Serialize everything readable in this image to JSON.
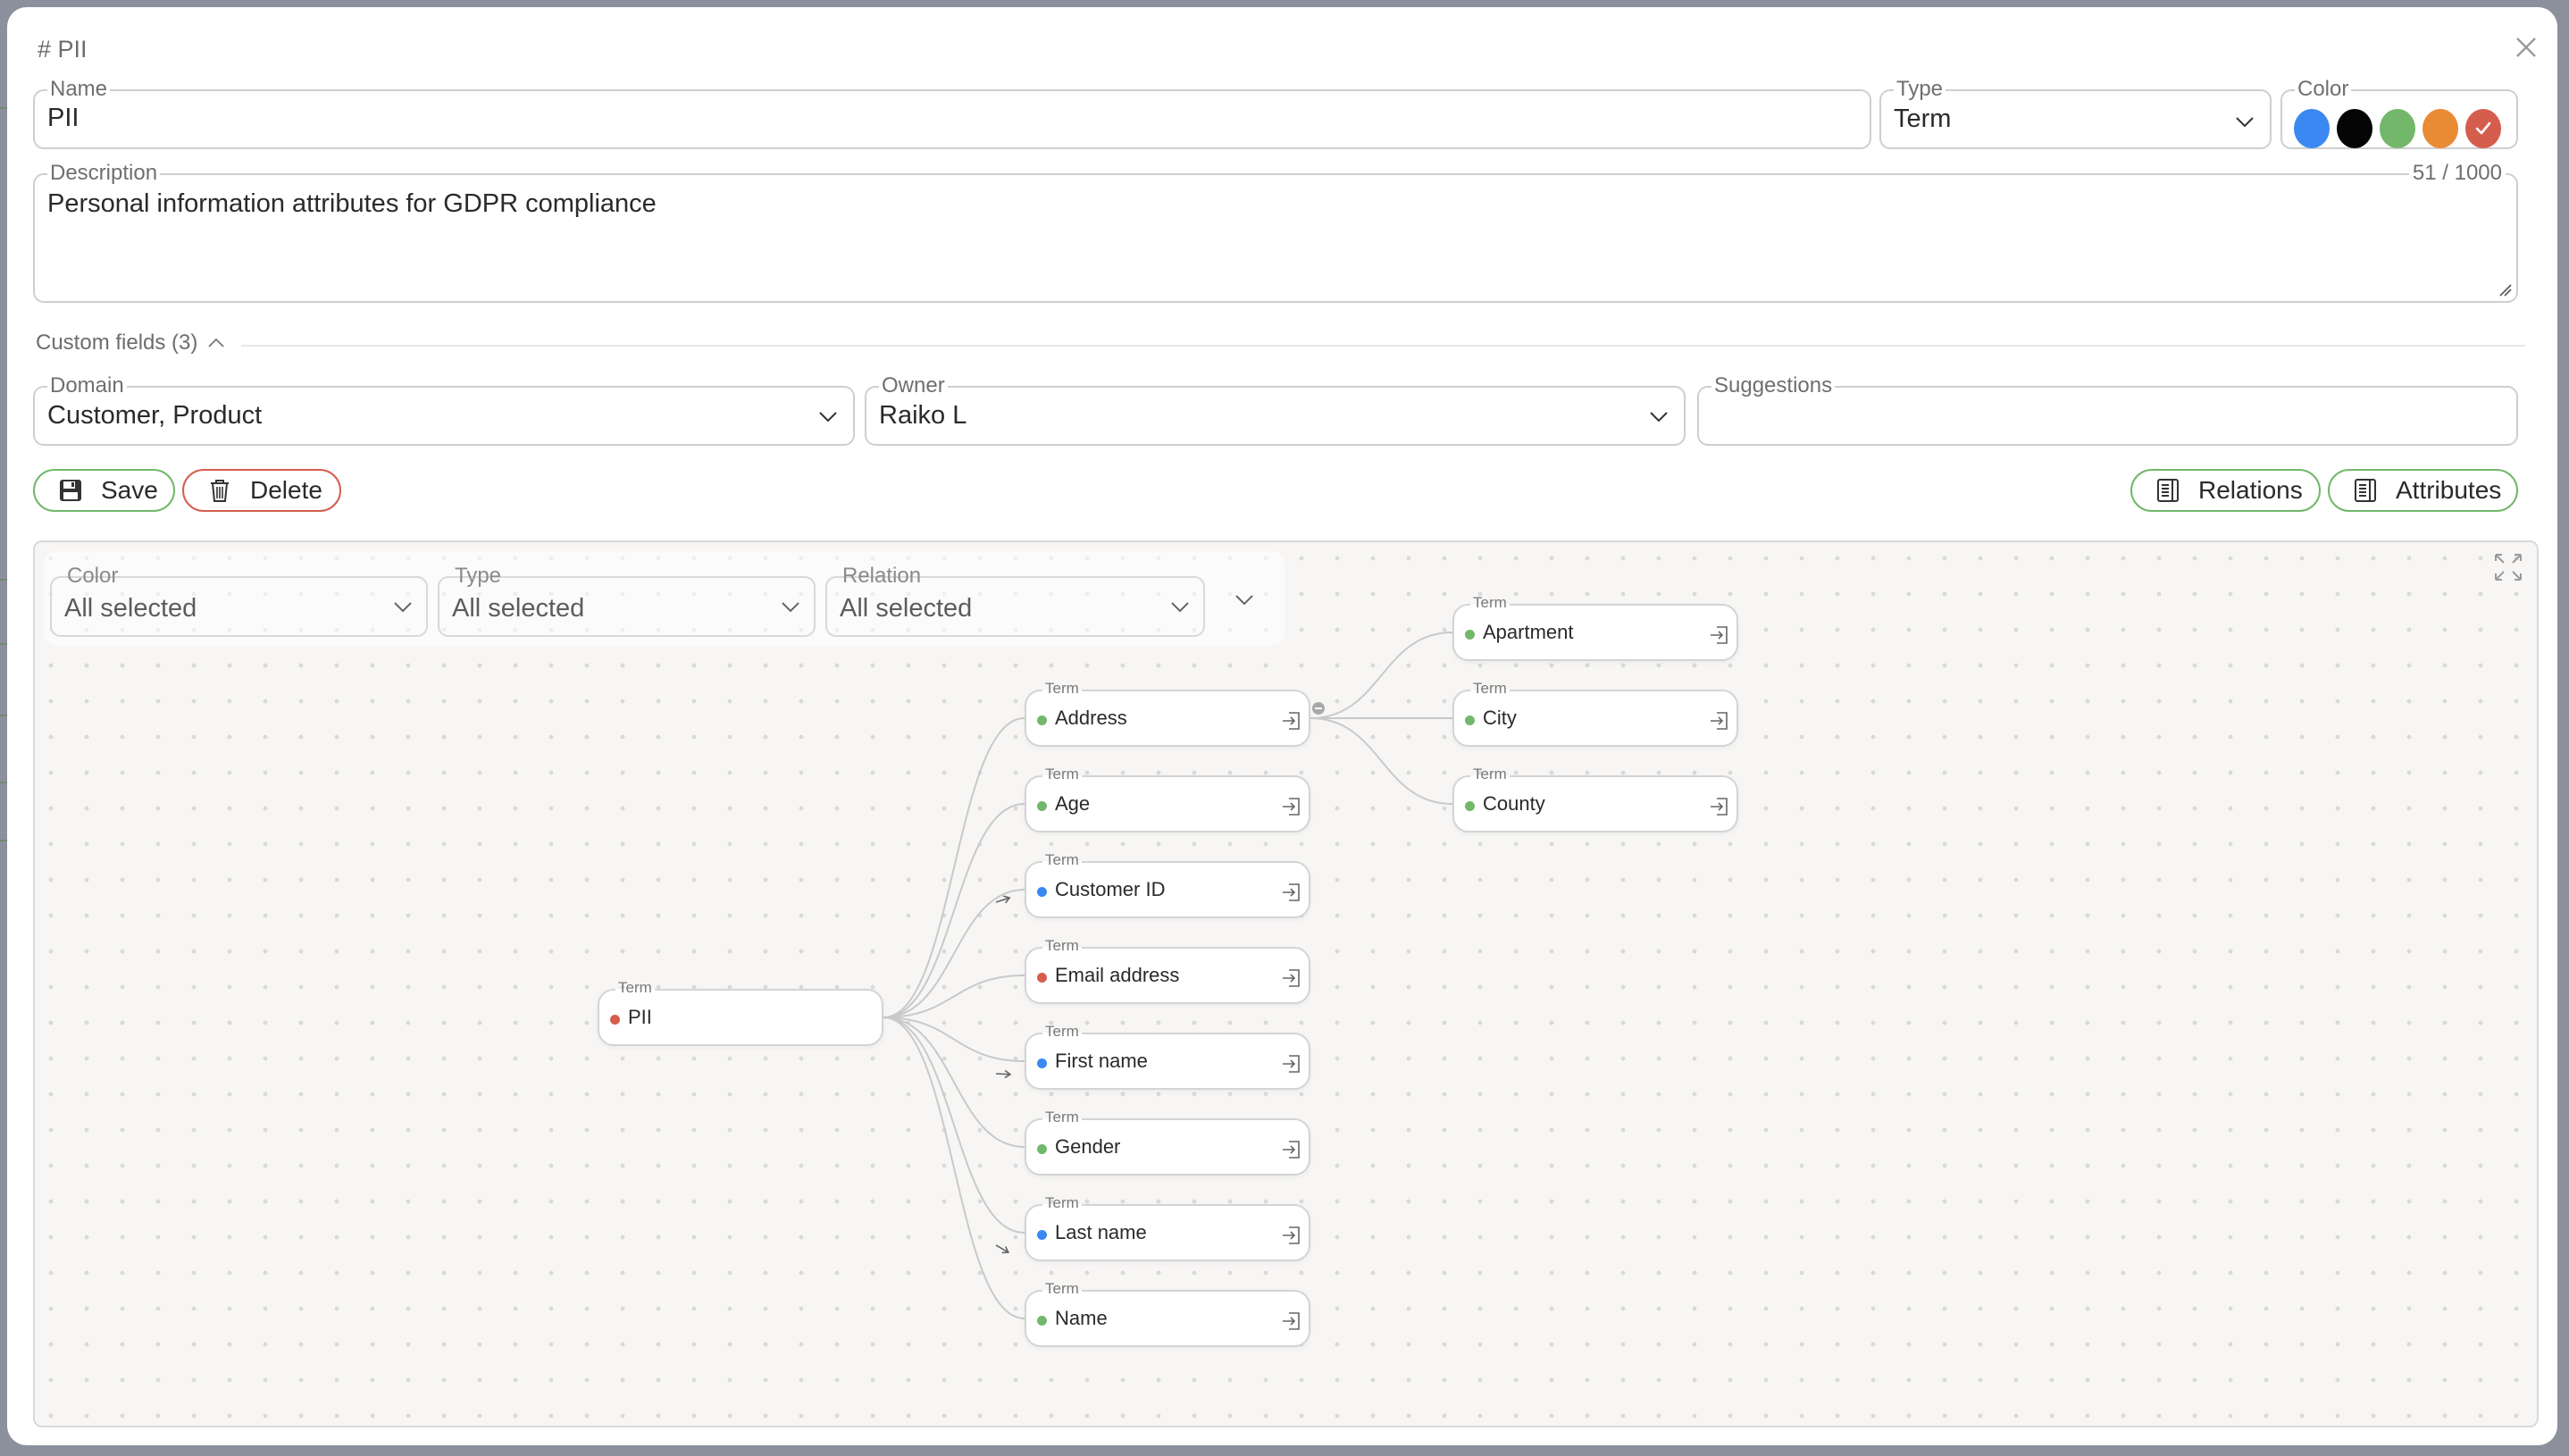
{
  "modal": {
    "title": "# PII",
    "close_icon": "close-icon"
  },
  "form": {
    "name": {
      "label": "Name",
      "value": "PII"
    },
    "type": {
      "label": "Type",
      "value": "Term"
    },
    "color": {
      "label": "Color",
      "swatches": [
        {
          "name": "blue",
          "hex": "#3b88f3",
          "selected": false
        },
        {
          "name": "black",
          "hex": "#050505",
          "selected": false
        },
        {
          "name": "green",
          "hex": "#72b76a",
          "selected": false
        },
        {
          "name": "orange",
          "hex": "#e98b35",
          "selected": false
        },
        {
          "name": "red",
          "hex": "#d55d4e",
          "selected": true
        }
      ]
    },
    "description": {
      "label": "Description",
      "value": "Personal information attributes for GDPR compliance",
      "counter": "51 / 1000"
    },
    "custom_fields": {
      "header": "Custom fields (3)",
      "domain": {
        "label": "Domain",
        "value": "Customer, Product"
      },
      "owner": {
        "label": "Owner",
        "value": "Raiko L"
      },
      "suggestions": {
        "label": "Suggestions",
        "value": ""
      }
    }
  },
  "actions": {
    "save_label": "Save",
    "delete_label": "Delete",
    "relations_label": "Relations",
    "attributes_label": "Attributes"
  },
  "graph": {
    "filters": {
      "color": {
        "label": "Color",
        "value": "All selected"
      },
      "type": {
        "label": "Type",
        "value": "All selected"
      },
      "relation": {
        "label": "Relation",
        "value": "All selected"
      }
    },
    "colors": {
      "green": "#72b76a",
      "blue": "#3b88f3",
      "red": "#d55d4e",
      "edge": "#c9c9c9"
    },
    "root": {
      "type": "Term",
      "label": "PII",
      "color": "red"
    },
    "children": [
      {
        "type": "Term",
        "label": "Address",
        "color": "green",
        "expanded": true
      },
      {
        "type": "Term",
        "label": "Age",
        "color": "green"
      },
      {
        "type": "Term",
        "label": "Customer ID",
        "color": "blue",
        "arrow": true
      },
      {
        "type": "Term",
        "label": "Email address",
        "color": "red"
      },
      {
        "type": "Term",
        "label": "First name",
        "color": "blue",
        "arrow": true
      },
      {
        "type": "Term",
        "label": "Gender",
        "color": "green"
      },
      {
        "type": "Term",
        "label": "Last name",
        "color": "blue",
        "arrow": true
      },
      {
        "type": "Term",
        "label": "Name",
        "color": "green"
      }
    ],
    "grandchildren": [
      {
        "type": "Term",
        "label": "Apartment",
        "color": "green"
      },
      {
        "type": "Term",
        "label": "City",
        "color": "green"
      },
      {
        "type": "Term",
        "label": "County",
        "color": "green"
      }
    ]
  }
}
